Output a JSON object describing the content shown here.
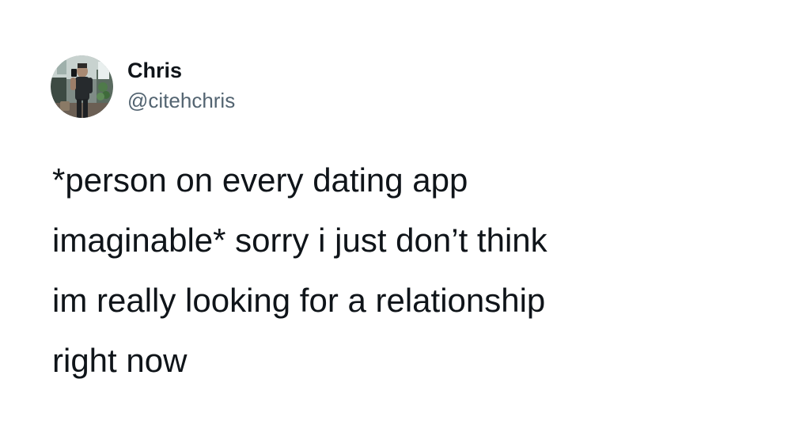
{
  "author": {
    "display_name": "Chris",
    "handle": "@citehchris"
  },
  "tweet": {
    "text": "*person on every dating app\nimaginable* sorry i just don’t think\nim really looking for a relationship\nright now"
  },
  "colors": {
    "text": "#0f1419",
    "secondary_text": "#536471",
    "background": "#ffffff"
  }
}
